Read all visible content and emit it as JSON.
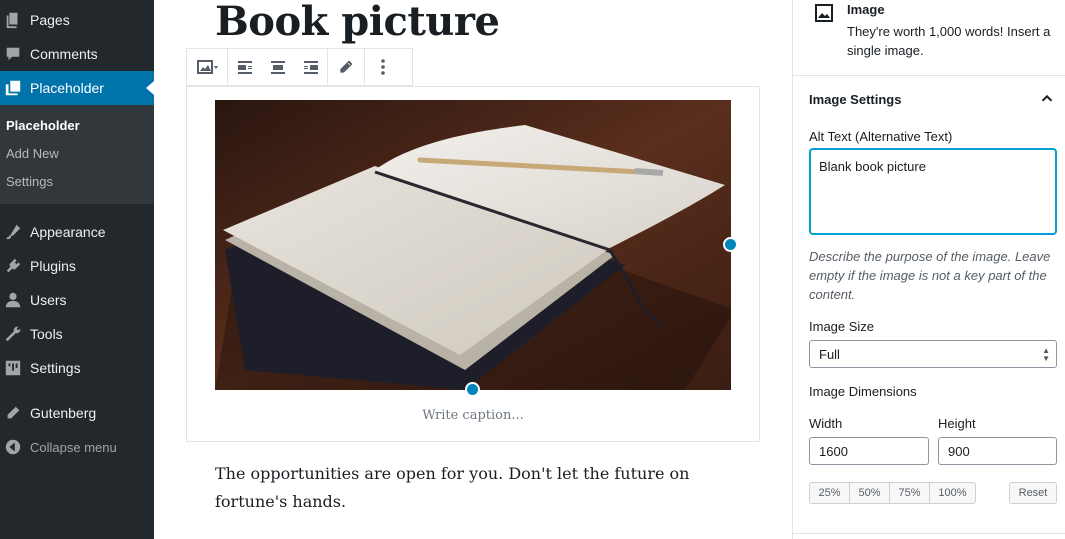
{
  "sidebar": {
    "items": [
      {
        "label": "Pages",
        "icon": "pages-icon"
      },
      {
        "label": "Comments",
        "icon": "comments-icon"
      },
      {
        "label": "Placeholder",
        "icon": "placeholder-icon"
      },
      {
        "label": "Appearance",
        "icon": "appearance-icon"
      },
      {
        "label": "Plugins",
        "icon": "plugins-icon"
      },
      {
        "label": "Users",
        "icon": "users-icon"
      },
      {
        "label": "Tools",
        "icon": "tools-icon"
      },
      {
        "label": "Settings",
        "icon": "settings-icon"
      },
      {
        "label": "Gutenberg",
        "icon": "gutenberg-icon"
      }
    ],
    "submenu": [
      "Placeholder",
      "Add New",
      "Settings"
    ],
    "collapse_label": "Collapse menu",
    "accent": "#0073aa",
    "background": "#23282d"
  },
  "editor": {
    "title": "Book picture",
    "caption_placeholder": "Write caption...",
    "paragraph": "The opportunities are open for you. Don't let the future on fortune's hands.",
    "toolbar_icons": [
      "image-type-icon",
      "align-left-icon",
      "align-center-icon",
      "align-right-icon",
      "edit-pencil-icon",
      "more-options-icon"
    ],
    "handle_color": "#0085ba"
  },
  "settings_panel": {
    "block": {
      "title": "Image",
      "description": "They're worth 1,000 words! Insert a single image.",
      "icon": "image-block-icon"
    },
    "image_settings": {
      "title": "Image Settings",
      "alt_label": "Alt Text (Alternative Text)",
      "alt_value": "Blank book picture",
      "alt_help": "Describe the purpose of the image. Leave empty if the image is not a key part of the content.",
      "size_label": "Image Size",
      "size_value": "Full",
      "dimensions_label": "Image Dimensions",
      "width_label": "Width",
      "width_value": "1600",
      "height_label": "Height",
      "height_value": "900",
      "percent_buttons": [
        "25%",
        "50%",
        "75%",
        "100%"
      ],
      "reset_label": "Reset"
    }
  }
}
